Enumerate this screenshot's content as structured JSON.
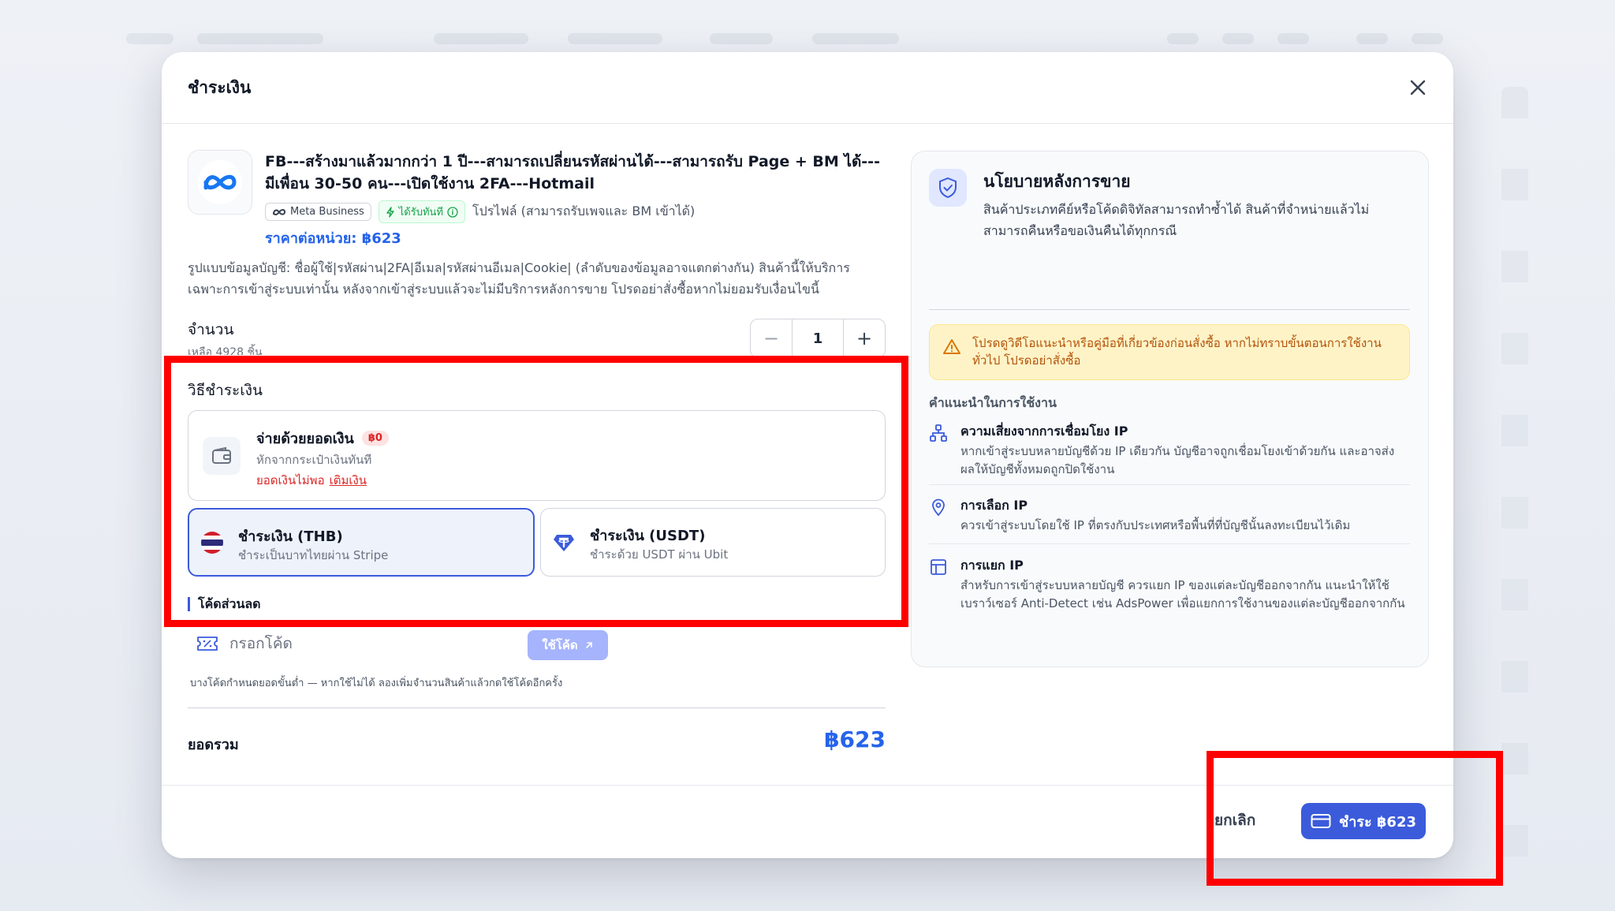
{
  "modal": {
    "title": "ชำระเงิน"
  },
  "product": {
    "title": "FB---สร้างมาแล้วมากกว่า 1 ปี---สามารถเปลี่ยนรหัสผ่านได้---สามารถรับ Page + BM ได้---มีเพื่อน 30-50 คน---เปิดใช้งาน 2FA---Hotmail",
    "tag_platform": "Meta Business",
    "tag_instant": "ได้รับทันที",
    "tag_profile": "โปรไฟล์ (สามารถรับเพจและ BM เข้าได้)",
    "unit_price": "ราคาต่อหน่วย: ฿623",
    "description": "รูปแบบข้อมูลบัญชี: ชื่อผู้ใช้|รหัสผ่าน|2FA|อีเมล|รหัสผ่านอีเมล|Cookie| (ลำดับของข้อมูลอาจแตกต่างกัน) สินค้านี้ให้บริการเฉพาะการเข้าสู่ระบบเท่านั้น หลังจากเข้าสู่ระบบแล้วจะไม่มีบริการหลังการขาย โปรดอย่าสั่งซื้อหากไม่ยอมรับเงื่อนไขนี้"
  },
  "quantity": {
    "label": "จำนวน",
    "stock": "เหลือ 4928 ชิ้น",
    "value": "1",
    "minus": "−",
    "plus": "+"
  },
  "payment": {
    "label": "วิธีชำระเงิน",
    "balance": {
      "title": "จ่ายด้วยยอดเงิน",
      "badge": "฿0",
      "subtitle": "หักจากกระเป๋าเงินทันที",
      "warning": "ยอดเงินไม่พอ",
      "topup": "เติมเงิน"
    },
    "methods": [
      {
        "title": "ชำระเงิน (THB)",
        "subtitle": "ชำระเป็นบาทไทยผ่าน Stripe",
        "selected": true
      },
      {
        "title": "ชำระเงิน (USDT)",
        "subtitle": "ชำระด้วย USDT ผ่าน Ubit",
        "selected": false
      }
    ]
  },
  "discount": {
    "label": "โค้ดส่วนลด",
    "placeholder": "กรอกโค้ด",
    "apply": "ใช้โค้ด",
    "hint": "บางโค้ดกำหนดยอดขั้นต่ำ — หากใช้ไม่ได้ ลองเพิ่มจำนวนสินค้าแล้วกดใช้โค้ดอีกครั้ง"
  },
  "total": {
    "label": "ยอดรวม",
    "value": "฿623"
  },
  "footer": {
    "cancel": "ยกเลิก",
    "pay": "ชำระ ฿623"
  },
  "policy": {
    "title": "นโยบายหลังการขาย",
    "text": "สินค้าประเภทคีย์หรือโค้ดดิจิทัลสามารถทำซ้ำได้ สินค้าที่จำหน่ายแล้วไม่สามารถคืนหรือขอเงินคืนได้ทุกกรณี",
    "warning": "โปรดดูวิดีโอแนะนำหรือคู่มือที่เกี่ยวข้องก่อนสั่งซื้อ หากไม่ทราบขั้นตอนการใช้งานทั่วไป โปรดอย่าสั่งซื้อ",
    "guide_title": "คำแนะนำในการใช้งาน",
    "guides": [
      {
        "title": "ความเสี่ยงจากการเชื่อมโยง IP",
        "text": "หากเข้าสู่ระบบหลายบัญชีด้วย IP เดียวกัน บัญชีอาจถูกเชื่อมโยงเข้าด้วยกัน และอาจส่งผลให้บัญชีทั้งหมดถูกปิดใช้งาน",
        "icon": "network-icon"
      },
      {
        "title": "การเลือก IP",
        "text": "ควรเข้าสู่ระบบโดยใช้ IP ที่ตรงกับประเทศหรือพื้นที่ที่บัญชีนั้นลงทะเบียนไว้เดิม",
        "icon": "location-pin-icon"
      },
      {
        "title": "การแยก IP",
        "text": "สำหรับการเข้าสู่ระบบหลายบัญชี ควรแยก IP ของแต่ละบัญชีออกจากกัน แนะนำให้ใช้เบราว์เซอร์ Anti-Detect เช่น AdsPower เพื่อแยกการใช้งานของแต่ละบัญชีออกจากกัน",
        "icon": "layout-icon"
      }
    ]
  },
  "colors": {
    "accent": "#3b5bdb",
    "price": "#2563eb",
    "danger": "#dc2626",
    "highlight": "#ff0000",
    "warning_bg": "#fef3c7"
  }
}
